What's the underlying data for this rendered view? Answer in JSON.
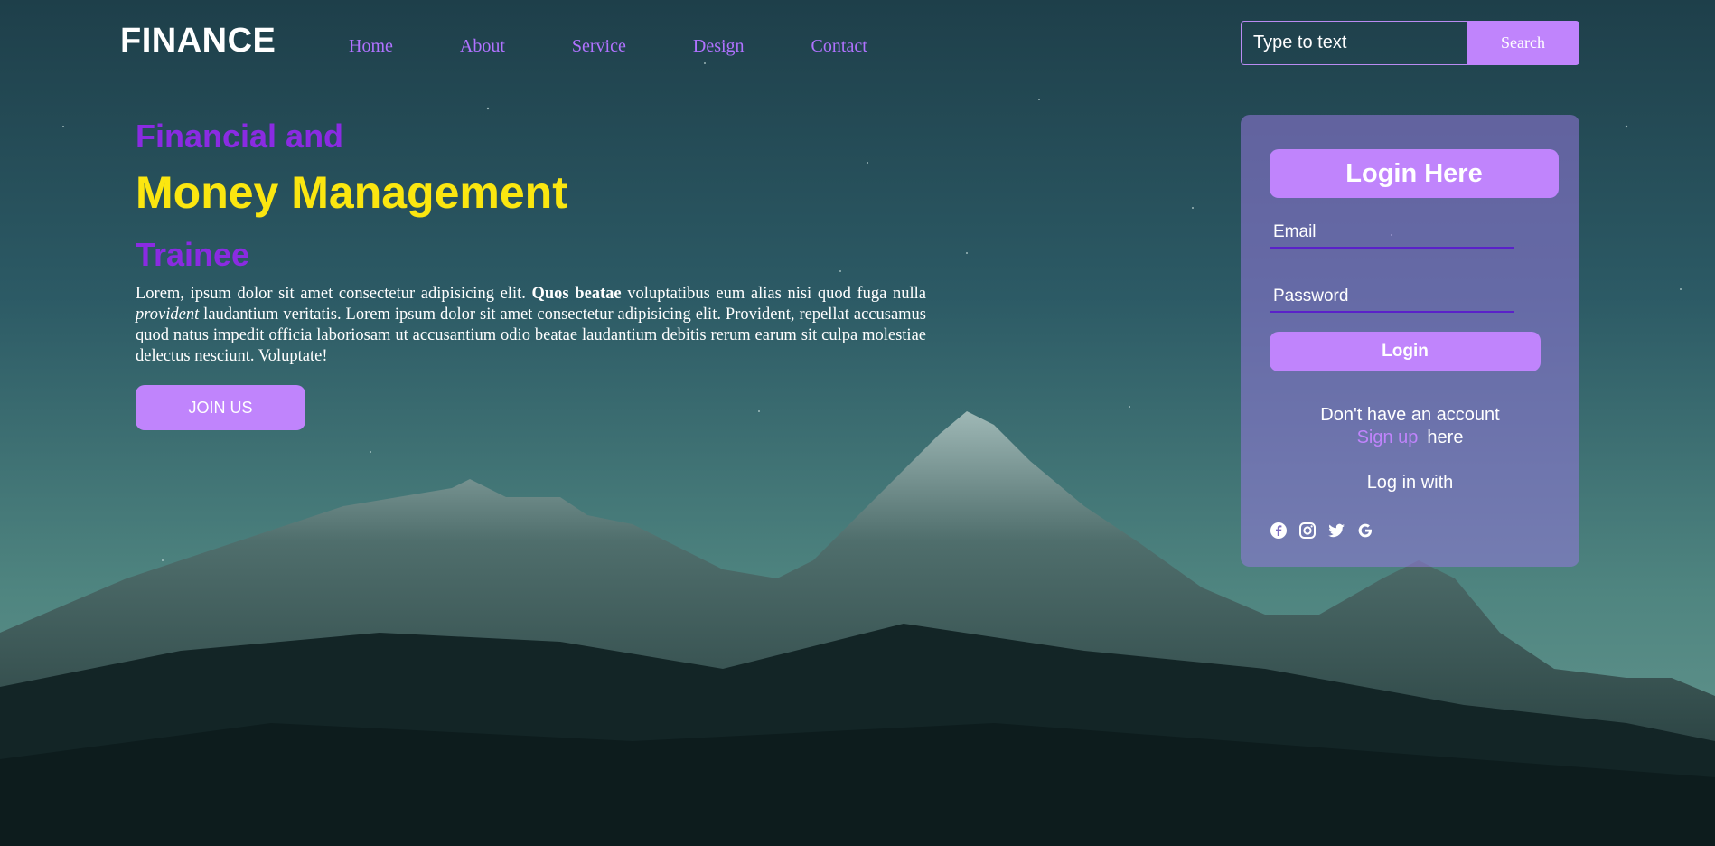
{
  "brand": {
    "logo": "FINANCE"
  },
  "nav": {
    "items": [
      "Home",
      "About",
      "Service",
      "Design",
      "Contact"
    ]
  },
  "search": {
    "placeholder": "Type to text",
    "button_label": "Search"
  },
  "hero": {
    "subtitle": "Financial and",
    "title": "Money Management",
    "tagline": "Trainee",
    "paragraph": {
      "part1": "Lorem, ipsum dolor sit amet consectetur adipisicing elit. ",
      "bold": "Quos beatae",
      "part2": " voluptatibus eum alias nisi quod fuga nulla ",
      "italic": "provident",
      "part3": " laudantium veritatis. Lorem ipsum dolor sit amet consectetur adipisicing elit. Provident, repellat accusamus quod natus impedit officia laboriosam ut accusantium odio beatae laudantium debitis rerum earum sit culpa molestiae delectus nesciunt. Voluptate!"
    },
    "cta_label": "JOIN US"
  },
  "login": {
    "title": "Login Here",
    "email_placeholder": "Email",
    "password_placeholder": "Password",
    "button_label": "Login",
    "signup_prompt": "Don't have an account",
    "signup_link": "Sign up",
    "signup_suffix": "here",
    "social_prompt": "Log in with",
    "social_icons": [
      "facebook-icon",
      "instagram-icon",
      "twitter-icon",
      "google-icon"
    ]
  },
  "colors": {
    "accent": "#c084fc",
    "purple_heading": "#8a2be2",
    "yellow_heading": "#fbe610",
    "nav_link": "#b072ff"
  }
}
